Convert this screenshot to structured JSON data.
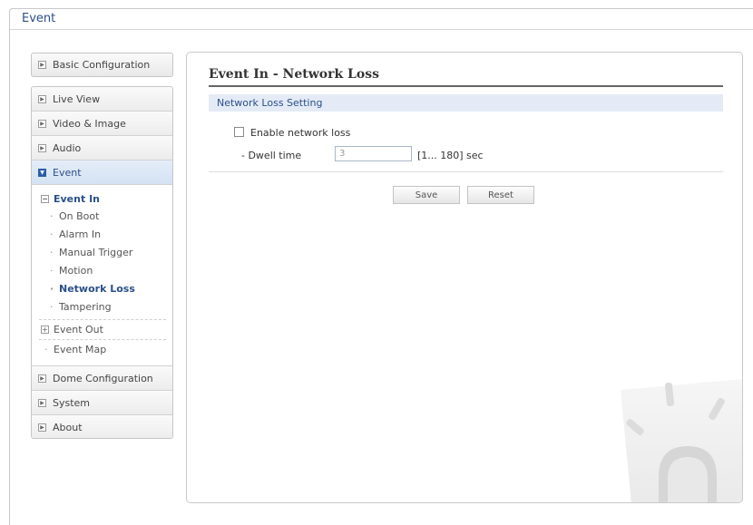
{
  "window": {
    "title": "Event"
  },
  "sidebar": {
    "basic_configuration": "Basic Configuration",
    "live_view": "Live View",
    "video_image": "Video & Image",
    "audio": "Audio",
    "event": "Event",
    "event_in": "Event In",
    "event_in_items": [
      "On Boot",
      "Alarm In",
      "Manual Trigger",
      "Motion",
      "Network Loss",
      "Tampering"
    ],
    "event_out": "Event Out",
    "event_map": "Event Map",
    "dome_configuration": "Dome Configuration",
    "system": "System",
    "about": "About",
    "selected_item": "Network Loss"
  },
  "main": {
    "title": "Event In - Network Loss",
    "section": "Network Loss Setting",
    "enable_label": "Enable network loss",
    "enable_checked": false,
    "dwell_label": "- Dwell time",
    "dwell_value": "3",
    "dwell_range": "[1... 180] sec",
    "save_label": "Save",
    "reset_label": "Reset"
  },
  "colors": {
    "accent": "#2b4f8a",
    "section_bg": "#e4ebf6",
    "active_bullet": "#2b5ea8"
  },
  "icons": {
    "nav_bullet": "arrow-box-icon",
    "tree_collapse": "minus-box-icon",
    "tree_expand": "plus-box-icon",
    "decoration": "alarm-beacon-icon"
  }
}
